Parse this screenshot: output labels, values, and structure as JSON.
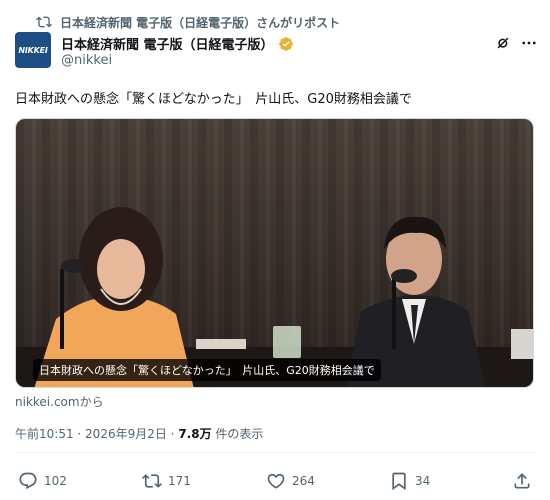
{
  "repost": {
    "text": "日本経済新聞 電子版（日経電子版）さんがリポスト",
    "icon": "repost-icon"
  },
  "author": {
    "avatar_text": "NIKKEI",
    "display_name": "日本経済新聞 電子版（日経電子版）",
    "handle": "@nikkei",
    "verified_icon": "verified-gold-badge-icon",
    "brand_color": "#1e4e86",
    "badge_color": "#e8b339"
  },
  "post": {
    "text": "日本財政への懸念「驚くほどなかった」　片山氏、G20財務相会議で"
  },
  "media": {
    "caption": "日本財政への懸念「驚くほどなかった」　片山氏、G20財務相会議で",
    "source": "nikkei.comから"
  },
  "meta": {
    "time": "午前10:51",
    "sep1": " · ",
    "date": "2026年9月2日",
    "sep2": " · ",
    "views": "7.8万",
    "views_suffix": " 件の表示"
  },
  "actions": {
    "replies": "102",
    "reposts": "171",
    "likes": "264",
    "bookmarks": "34"
  },
  "icons": {
    "grok": "grok-icon",
    "more": "more-icon",
    "reply": "reply-icon",
    "repost": "repost-icon",
    "like": "heart-icon",
    "bookmark": "bookmark-icon",
    "share": "share-icon"
  },
  "colors": {
    "text_primary": "#0f1419",
    "text_secondary": "#536471",
    "divider": "#eff3f4"
  }
}
